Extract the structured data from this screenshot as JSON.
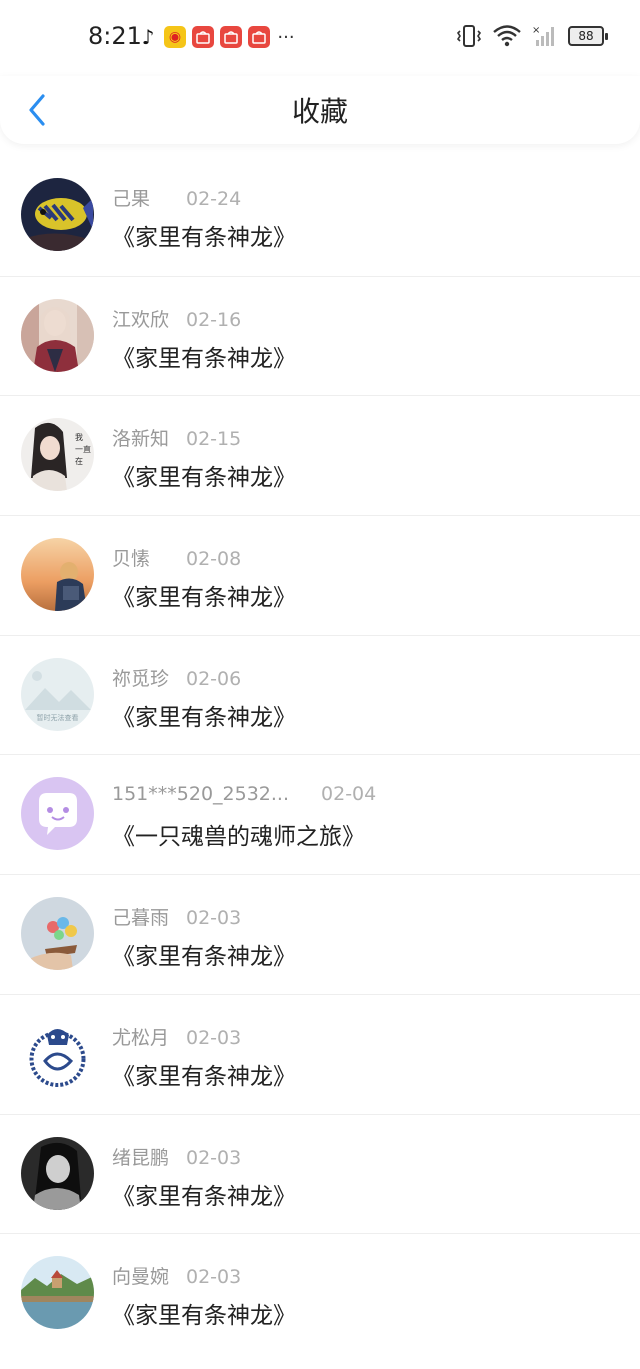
{
  "status_bar": {
    "time": "8:21",
    "battery": "88",
    "app_icons": [
      "tiktok-icon",
      "weibo-icon",
      "huawei-icon",
      "huawei-icon",
      "huawei-icon"
    ],
    "more_glyph": "···"
  },
  "header": {
    "title": "收藏",
    "back_icon": "chevron-left-icon"
  },
  "accent_color": "#2b8ef0",
  "favorites": [
    {
      "name": "己果",
      "date": "02-24",
      "title": "《家里有条神龙》"
    },
    {
      "name": "江欢欣",
      "date": "02-16",
      "title": "《家里有条神龙》"
    },
    {
      "name": "洛新知",
      "date": "02-15",
      "title": "《家里有条神龙》"
    },
    {
      "name": "贝愫",
      "date": "02-08",
      "title": "《家里有条神龙》"
    },
    {
      "name": "祢觅珍",
      "date": "02-06",
      "title": "《家里有条神龙》"
    },
    {
      "name": "151***520_2532...",
      "date": "02-04",
      "title": "《一只魂兽的魂师之旅》"
    },
    {
      "name": "己暮雨",
      "date": "02-03",
      "title": "《家里有条神龙》"
    },
    {
      "name": "尤松月",
      "date": "02-03",
      "title": "《家里有条神龙》"
    },
    {
      "name": "绪昆鹏",
      "date": "02-03",
      "title": "《家里有条神龙》"
    },
    {
      "name": "向曼婉",
      "date": "02-03",
      "title": "《家里有条神龙》"
    }
  ],
  "avatar_image_text": {
    "item_3": "我一直在",
    "item_5": "暂时无法查看"
  }
}
